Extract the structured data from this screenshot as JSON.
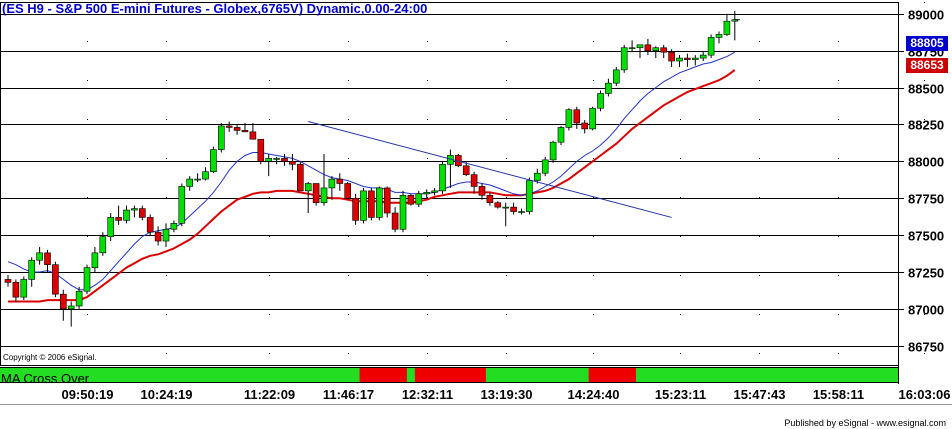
{
  "chart_title": "(ES H9 - S&P 500 E-mini Futures - Globex,6765V) Dynamic,0.00-24:00",
  "copyright": "Copyright © 2006 eSignal.",
  "indicator_label": "MA Cross Over",
  "published": "Published by eSignal - www.esignal.com",
  "price_tags": [
    {
      "label": "88805",
      "color": "#0000cc"
    },
    {
      "label": "88653",
      "color": "#cc0000"
    }
  ],
  "colors": {
    "up": "#00e000",
    "down": "#dd0000",
    "ma_fast": "#2233cc",
    "ma_slow": "#dd0000",
    "trendline": "#2233aa"
  },
  "chart_data": {
    "type": "candlestick",
    "title": "(ES H9 - S&P 500 E-mini Futures - Globex,6765V) Dynamic,0.00-24:00",
    "xlabel": "",
    "ylabel": "",
    "ylim": [
      86620,
      89080
    ],
    "y_ticks": [
      89000,
      88750,
      88500,
      88250,
      88000,
      87750,
      87500,
      87250,
      87000,
      86750
    ],
    "x_ticks": [
      {
        "label": "09:50:19",
        "bar": 10
      },
      {
        "label": "10:24:19",
        "bar": 20
      },
      {
        "label": "11:22:09",
        "bar": 33
      },
      {
        "label": "11:46:17",
        "bar": 43
      },
      {
        "label": "12:32:11",
        "bar": 53
      },
      {
        "label": "13:19:30",
        "bar": 63
      },
      {
        "label": "14:24:40",
        "bar": 74
      },
      {
        "label": "15:23:11",
        "bar": 85
      },
      {
        "label": "15:47:43",
        "bar": 95
      },
      {
        "label": "15:58:11",
        "bar": 105
      },
      {
        "label": "16:03:06",
        "bar": 116
      }
    ],
    "grid": true,
    "bars": [
      [
        87200,
        87230,
        87150,
        87180
      ],
      [
        87180,
        87200,
        87050,
        87080
      ],
      [
        87080,
        87220,
        87060,
        87200
      ],
      [
        87200,
        87350,
        87150,
        87330
      ],
      [
        87330,
        87420,
        87300,
        87380
      ],
      [
        87380,
        87400,
        87250,
        87300
      ],
      [
        87300,
        87320,
        87080,
        87100
      ],
      [
        87100,
        87130,
        86920,
        87000
      ],
      [
        87000,
        87050,
        86880,
        87020
      ],
      [
        87020,
        87150,
        87000,
        87120
      ],
      [
        87120,
        87300,
        87100,
        87280
      ],
      [
        87280,
        87420,
        87250,
        87380
      ],
      [
        87380,
        87520,
        87360,
        87490
      ],
      [
        87490,
        87650,
        87460,
        87620
      ],
      [
        87620,
        87700,
        87570,
        87600
      ],
      [
        87600,
        87700,
        87580,
        87670
      ],
      [
        87670,
        87700,
        87620,
        87680
      ],
      [
        87680,
        87700,
        87600,
        87620
      ],
      [
        87620,
        87640,
        87500,
        87520
      ],
      [
        87520,
        87560,
        87430,
        87460
      ],
      [
        87460,
        87580,
        87420,
        87540
      ],
      [
        87540,
        87600,
        87520,
        87580
      ],
      [
        87580,
        87850,
        87560,
        87830
      ],
      [
        87830,
        87900,
        87800,
        87880
      ],
      [
        87880,
        87920,
        87860,
        87880
      ],
      [
        87880,
        87960,
        87870,
        87930
      ],
      [
        87930,
        88100,
        87920,
        88080
      ],
      [
        88080,
        88260,
        88060,
        88240
      ],
      [
        88240,
        88270,
        88200,
        88230
      ],
      [
        88230,
        88250,
        88180,
        88210
      ],
      [
        88210,
        88260,
        88200,
        88200
      ],
      [
        88200,
        88260,
        88150,
        88150
      ],
      [
        88150,
        88150,
        87980,
        88000
      ],
      [
        88000,
        88050,
        87900,
        88020
      ],
      [
        88020,
        88030,
        87980,
        88020
      ],
      [
        88020,
        88050,
        87970,
        88000
      ],
      [
        88000,
        88050,
        87940,
        87980
      ],
      [
        87980,
        88000,
        87800,
        87800
      ],
      [
        87800,
        87860,
        87650,
        87850
      ],
      [
        87850,
        87850,
        87700,
        87720
      ],
      [
        87720,
        88050,
        87700,
        87820
      ],
      [
        87820,
        87900,
        87740,
        87880
      ],
      [
        87880,
        87920,
        87800,
        87850
      ],
      [
        87850,
        87860,
        87740,
        87750
      ],
      [
        87750,
        87780,
        87570,
        87600
      ],
      [
        87600,
        87820,
        87580,
        87800
      ],
      [
        87800,
        87820,
        87600,
        87620
      ],
      [
        87620,
        87830,
        87600,
        87820
      ],
      [
        87820,
        87830,
        87620,
        87650
      ],
      [
        87650,
        87690,
        87520,
        87540
      ],
      [
        87540,
        87800,
        87520,
        87770
      ],
      [
        87770,
        87780,
        87700,
        87710
      ],
      [
        87710,
        87800,
        87690,
        87780
      ],
      [
        87780,
        87810,
        87750,
        87790
      ],
      [
        87790,
        87820,
        87770,
        87800
      ],
      [
        87800,
        88000,
        87780,
        87980
      ],
      [
        87980,
        88080,
        87820,
        88040
      ],
      [
        88040,
        88050,
        87960,
        87970
      ],
      [
        87970,
        88000,
        87900,
        87910
      ],
      [
        87910,
        87930,
        87780,
        87830
      ],
      [
        87830,
        87850,
        87740,
        87770
      ],
      [
        87770,
        87790,
        87700,
        87720
      ],
      [
        87720,
        87730,
        87680,
        87690
      ],
      [
        87690,
        87720,
        87560,
        87690
      ],
      [
        87690,
        87720,
        87640,
        87660
      ],
      [
        87660,
        87680,
        87640,
        87660
      ],
      [
        87660,
        87890,
        87640,
        87870
      ],
      [
        87870,
        87950,
        87850,
        87920
      ],
      [
        87920,
        88030,
        87900,
        88010
      ],
      [
        88010,
        88140,
        87990,
        88130
      ],
      [
        88130,
        88240,
        88110,
        88230
      ],
      [
        88230,
        88360,
        88210,
        88350
      ],
      [
        88350,
        88370,
        88220,
        88260
      ],
      [
        88260,
        88280,
        88190,
        88220
      ],
      [
        88220,
        88370,
        88210,
        88360
      ],
      [
        88360,
        88480,
        88340,
        88460
      ],
      [
        88460,
        88560,
        88440,
        88530
      ],
      [
        88530,
        88640,
        88510,
        88620
      ],
      [
        88620,
        88790,
        88600,
        88770
      ],
      [
        88770,
        88820,
        88740,
        88770
      ],
      [
        88770,
        88790,
        88700,
        88790
      ],
      [
        88790,
        88830,
        88720,
        88750
      ],
      [
        88750,
        88780,
        88700,
        88770
      ],
      [
        88770,
        88790,
        88700,
        88740
      ],
      [
        88740,
        88760,
        88640,
        88680
      ],
      [
        88680,
        88720,
        88640,
        88700
      ],
      [
        88700,
        88730,
        88640,
        88690
      ],
      [
        88690,
        88720,
        88650,
        88700
      ],
      [
        88700,
        88740,
        88680,
        88720
      ],
      [
        88720,
        88860,
        88700,
        88840
      ],
      [
        88840,
        88880,
        88800,
        88860
      ],
      [
        88860,
        89000,
        88850,
        88950
      ],
      [
        88950,
        89020,
        88820,
        88960
      ]
    ],
    "ma_fast": [
      87320,
      87300,
      87270,
      87250,
      87250,
      87260,
      87240,
      87200,
      87160,
      87130,
      87130,
      87160,
      87200,
      87260,
      87320,
      87380,
      87440,
      87490,
      87520,
      87530,
      87540,
      87550,
      87580,
      87630,
      87680,
      87730,
      87790,
      87860,
      87940,
      88000,
      88040,
      88060,
      88060,
      88050,
      88040,
      88030,
      88020,
      88000,
      87970,
      87940,
      87910,
      87890,
      87880,
      87870,
      87850,
      87830,
      87820,
      87820,
      87810,
      87790,
      87790,
      87780,
      87780,
      87780,
      87790,
      87810,
      87830,
      87850,
      87860,
      87860,
      87850,
      87840,
      87820,
      87800,
      87780,
      87770,
      87780,
      87800,
      87830,
      87860,
      87900,
      87950,
      88000,
      88040,
      88070,
      88110,
      88160,
      88220,
      88290,
      88350,
      88410,
      88460,
      88500,
      88540,
      88570,
      88600,
      88620,
      88640,
      88660,
      88670,
      88690,
      88710,
      88740
    ],
    "ma_slow": [
      87050,
      87050,
      87050,
      87050,
      87050,
      87060,
      87060,
      87060,
      87060,
      87060,
      87080,
      87120,
      87160,
      87200,
      87240,
      87280,
      87310,
      87340,
      87360,
      87370,
      87390,
      87410,
      87440,
      87470,
      87510,
      87560,
      87610,
      87660,
      87700,
      87740,
      87760,
      87780,
      87790,
      87790,
      87800,
      87800,
      87800,
      87790,
      87780,
      87770,
      87760,
      87750,
      87750,
      87740,
      87730,
      87730,
      87730,
      87730,
      87720,
      87720,
      87720,
      87720,
      87730,
      87740,
      87760,
      87770,
      87780,
      87790,
      87790,
      87790,
      87790,
      87790,
      87780,
      87770,
      87770,
      87770,
      87780,
      87790,
      87800,
      87820,
      87850,
      87880,
      87920,
      87960,
      88000,
      88040,
      88080,
      88120,
      88170,
      88220,
      88260,
      88300,
      88340,
      88380,
      88410,
      88440,
      88470,
      88490,
      88510,
      88530,
      88550,
      88580,
      88620
    ],
    "trendline": {
      "from": {
        "bar": 38,
        "price": 88270
      },
      "to": {
        "bar": 84,
        "price": 87620
      }
    },
    "ma_cross_segments": [
      {
        "from_bar": 0,
        "to_bar": 14,
        "state": "up"
      },
      {
        "from_bar": 14,
        "to_bar": 45,
        "state": "up"
      },
      {
        "from_bar": 45,
        "to_bar": 51,
        "state": "down"
      },
      {
        "from_bar": 51,
        "to_bar": 52,
        "state": "up"
      },
      {
        "from_bar": 52,
        "to_bar": 61,
        "state": "down"
      },
      {
        "from_bar": 61,
        "to_bar": 67,
        "state": "up"
      },
      {
        "from_bar": 67,
        "to_bar": 73,
        "state": "up"
      },
      {
        "from_bar": 73,
        "to_bar": 74,
        "state": "up"
      },
      {
        "from_bar": 74,
        "to_bar": 80,
        "state": "down"
      },
      {
        "from_bar": 80,
        "to_bar": 93,
        "state": "up"
      }
    ]
  }
}
